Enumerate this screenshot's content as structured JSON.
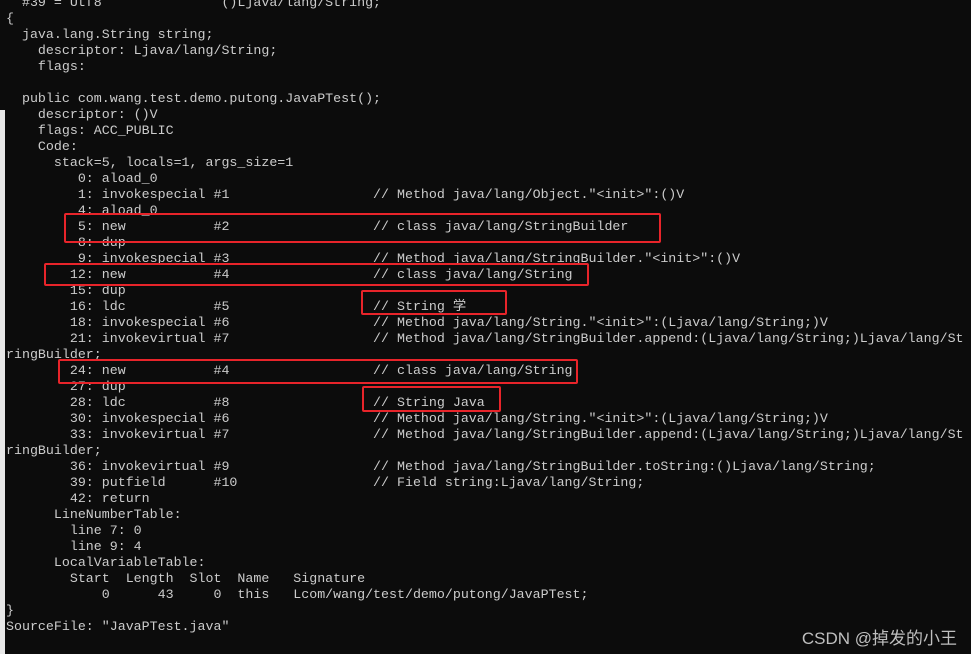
{
  "terminal": {
    "lines": [
      "  #39 = Utf8               ()Ljava/lang/String;",
      "{",
      "  java.lang.String string;",
      "    descriptor: Ljava/lang/String;",
      "    flags:",
      "",
      "  public com.wang.test.demo.putong.JavaPTest();",
      "    descriptor: ()V",
      "    flags: ACC_PUBLIC",
      "    Code:",
      "      stack=5, locals=1, args_size=1",
      "         0: aload_0",
      "         1: invokespecial #1                  // Method java/lang/Object.\"<init>\":()V",
      "         4: aload_0",
      "         5: new           #2                  // class java/lang/StringBuilder",
      "         8: dup",
      "         9: invokespecial #3                  // Method java/lang/StringBuilder.\"<init>\":()V",
      "        12: new           #4                  // class java/lang/String",
      "        15: dup",
      "        16: ldc           #5                  // String 学",
      "        18: invokespecial #6                  // Method java/lang/String.\"<init>\":(Ljava/lang/String;)V",
      "        21: invokevirtual #7                  // Method java/lang/StringBuilder.append:(Ljava/lang/String;)Ljava/lang/St",
      "ringBuilder;",
      "        24: new           #4                  // class java/lang/String",
      "        27: dup",
      "        28: ldc           #8                  // String Java",
      "        30: invokespecial #6                  // Method java/lang/String.\"<init>\":(Ljava/lang/String;)V",
      "        33: invokevirtual #7                  // Method java/lang/StringBuilder.append:(Ljava/lang/String;)Ljava/lang/St",
      "ringBuilder;",
      "        36: invokevirtual #9                  // Method java/lang/StringBuilder.toString:()Ljava/lang/String;",
      "        39: putfield      #10                 // Field string:Ljava/lang/String;",
      "        42: return",
      "      LineNumberTable:",
      "        line 7: 0",
      "        line 9: 4",
      "      LocalVariableTable:",
      "        Start  Length  Slot  Name   Signature",
      "            0      43     0  this   Lcom/wang/test/demo/putong/JavaPTest;",
      "}",
      "SourceFile: \"JavaPTest.java\""
    ]
  },
  "watermark": "CSDN @掉发的小王",
  "colors": {
    "highlight_box": "#e8242a",
    "background": "#0c0c0c",
    "text": "#cccccc"
  }
}
